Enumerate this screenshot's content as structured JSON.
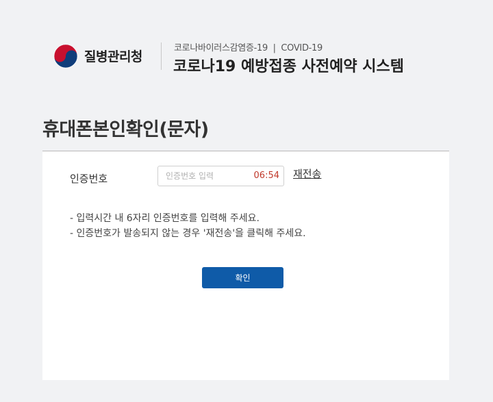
{
  "header": {
    "agency_name": "질병관리청",
    "subtitle": "코로나바이러스감염증-19  |  COVID-19",
    "system_title": "코로나19 예방접종 사전예약 시스템",
    "logo_icon": "taegeuk-logo-icon",
    "colors": {
      "logo_red": "#c8102e",
      "logo_blue": "#0f3d7a"
    }
  },
  "page": {
    "title": "휴대폰본인확인(문자)"
  },
  "form": {
    "label": "인증번호",
    "placeholder": "인증번호 입력",
    "value": "",
    "timer": "06:54",
    "resend_label": "재전송",
    "timer_color": "#c0392b"
  },
  "notes": [
    "- 입력시간 내 6자리 인증번호를 입력해 주세요.",
    "- 인증번호가 발송되지 않는 경우 '재전송'을 클릭해 주세요."
  ],
  "confirm_button": {
    "label": "확인",
    "color": "#0f5ba8"
  }
}
